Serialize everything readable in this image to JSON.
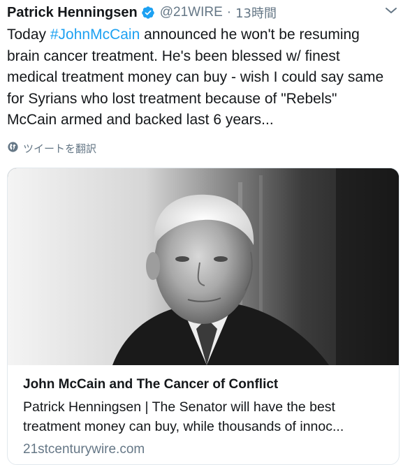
{
  "tweet": {
    "author_name": "Patrick Henningsen",
    "handle": "@21WIRE",
    "separator": "·",
    "time": "13時間",
    "text_lines": [
      {
        "before": "Today ",
        "hashtag": "#JohnMcCain",
        "after": " announced he won't be resuming"
      },
      {
        "text": "brain cancer treatment. He's been blessed w/ finest"
      },
      {
        "text": "medical treatment money can buy - wish I could say same"
      },
      {
        "text": "for Syrians who lost treatment because of \"Rebels\""
      },
      {
        "text": "McCain armed and backed last 6 years..."
      }
    ],
    "translate_label": "ツイートを翻訳"
  },
  "card": {
    "title": "John McCain and The Cancer of Conflict",
    "description_lines": [
      "Patrick Henningsen | The Senator will have the best",
      "treatment money can buy, while thousands of innoc..."
    ],
    "domain": "21stcenturywire.com"
  },
  "colors": {
    "link": "#1da1f2",
    "secondary_text": "#657786",
    "verified_badge": "#1da1f2",
    "card_border": "#e1e8ed"
  },
  "icons": {
    "verified": "verified-badge-icon",
    "caret": "chevron-down-icon",
    "globe": "globe-icon"
  }
}
